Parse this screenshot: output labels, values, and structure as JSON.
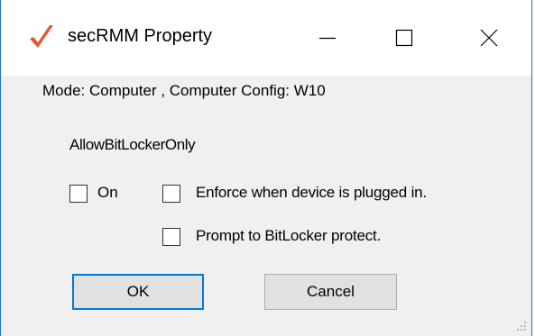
{
  "window": {
    "title": "secRMM Property",
    "app_icon": "checkmark-icon",
    "controls": {
      "minimize_icon": "minimize-icon",
      "maximize_icon": "maximize-icon",
      "close_icon": "close-icon"
    },
    "accent_color": "#1e72c8"
  },
  "dialog": {
    "mode_text": "Mode: Computer , Computer Config: W10",
    "setting_name": "AllowBitLockerOnly",
    "checkboxes": [
      {
        "label": "On",
        "checked": false
      },
      {
        "label": "Enforce when device is plugged in.",
        "checked": false
      },
      {
        "label": "Prompt to BitLocker protect.",
        "checked": false
      }
    ],
    "buttons": {
      "ok_label": "OK",
      "cancel_label": "Cancel"
    }
  }
}
